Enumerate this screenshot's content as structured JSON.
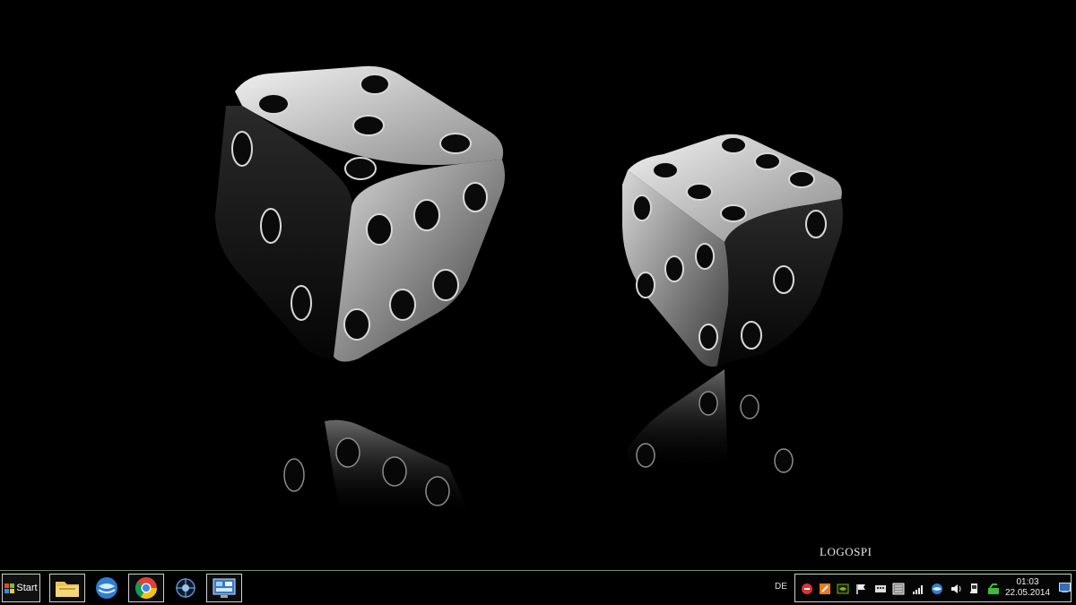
{
  "desktop": {
    "wallpaper": "black-and-white-dice",
    "watermark": "LOGOSPI"
  },
  "taskbar": {
    "start_label": "Start",
    "pinned": [
      {
        "name": "file-explorer",
        "icon": "folder-icon"
      },
      {
        "name": "thunderbird",
        "icon": "mail-icon"
      },
      {
        "name": "chrome",
        "icon": "chrome-icon"
      },
      {
        "name": "game-app",
        "icon": "emblem-icon"
      },
      {
        "name": "control-panel",
        "icon": "control-panel-icon"
      }
    ],
    "language": "DE",
    "tray_icons": [
      "security-icon",
      "update-icon",
      "nvidia-icon",
      "flag-icon",
      "keyboard-icon",
      "display-icon",
      "signal-icon",
      "network-icon",
      "volume-icon",
      "usb-icon",
      "sync-icon"
    ],
    "clock": {
      "time": "01:03",
      "date": "22.05.2014"
    },
    "colors": {
      "border": "#cfcfcf",
      "accent_line": "#6c8f6c"
    }
  }
}
